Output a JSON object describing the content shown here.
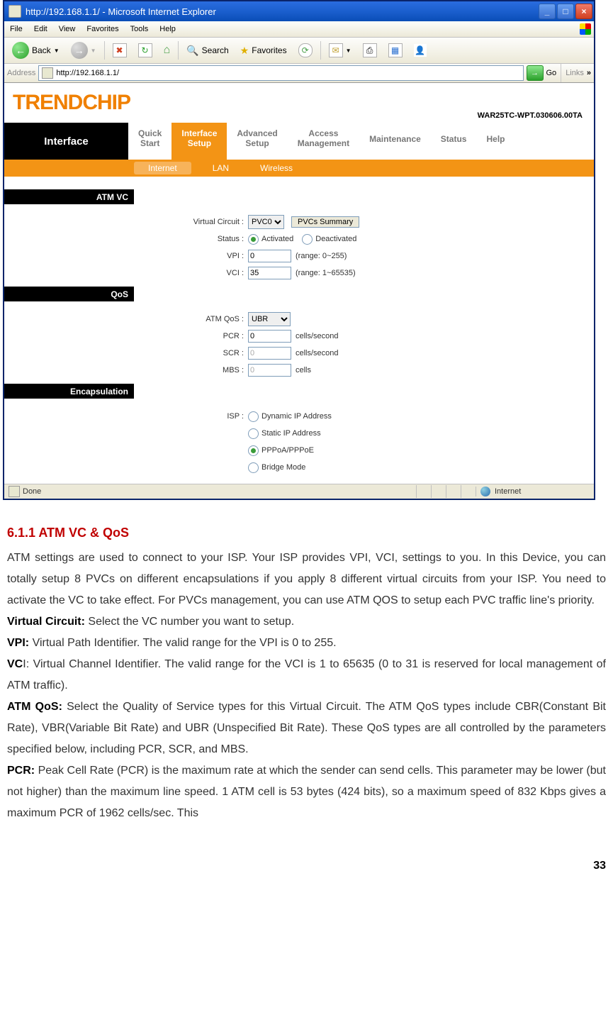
{
  "window": {
    "title": "http://192.168.1.1/ - Microsoft Internet Explorer"
  },
  "menubar": [
    "File",
    "Edit",
    "View",
    "Favorites",
    "Tools",
    "Help"
  ],
  "toolbar": {
    "back": "Back",
    "search": "Search",
    "favorites": "Favorites"
  },
  "addressbar": {
    "label": "Address",
    "url": "http://192.168.1.1/",
    "go": "Go",
    "links": "Links"
  },
  "brand": {
    "logo": "TRENDCHIP",
    "firmware": "WAR25TC-WPT.030606.00TA"
  },
  "sidetitle": "Interface",
  "tabs": {
    "quick": {
      "l1": "Quick",
      "l2": "Start"
    },
    "iface": {
      "l1": "Interface",
      "l2": "Setup"
    },
    "adv": {
      "l1": "Advanced",
      "l2": "Setup"
    },
    "acc": {
      "l1": "Access",
      "l2": "Management"
    },
    "maint": {
      "l1": "Maintenance",
      "l2": ""
    },
    "status": {
      "l1": "Status",
      "l2": ""
    },
    "help": {
      "l1": "Help",
      "l2": ""
    }
  },
  "subtabs": {
    "internet": "Internet",
    "lan": "LAN",
    "wireless": "Wireless"
  },
  "sections": {
    "atmvc": "ATM VC",
    "qos": "QoS",
    "encap": "Encapsulation"
  },
  "atm": {
    "vc_label": "Virtual Circuit :",
    "vc_value": "PVC0",
    "pvcs_btn": "PVCs Summary",
    "status_label": "Status :",
    "status_on": "Activated",
    "status_off": "Deactivated",
    "vpi_label": "VPI :",
    "vpi_value": "0",
    "vpi_hint": "(range: 0~255)",
    "vci_label": "VCI :",
    "vci_value": "35",
    "vci_hint": "(range: 1~65535)"
  },
  "qos": {
    "type_label": "ATM QoS :",
    "type_value": "UBR",
    "pcr_label": "PCR :",
    "pcr_value": "0",
    "pcr_hint": "cells/second",
    "scr_label": "SCR :",
    "scr_value": "0",
    "scr_hint": "cells/second",
    "mbs_label": "MBS :",
    "mbs_value": "0",
    "mbs_hint": "cells"
  },
  "isp": {
    "label": "ISP :",
    "opt1": "Dynamic IP Address",
    "opt2": "Static IP Address",
    "opt3": "PPPoA/PPPoE",
    "opt4": "Bridge Mode"
  },
  "statusbar": {
    "done": "Done",
    "zone": "Internet"
  },
  "doc": {
    "heading": "6.1.1 ATM VC & QoS",
    "p1": "ATM settings are used to connect to your ISP. Your ISP provides VPI, VCI, settings to you. In this Device, you can totally setup 8 PVCs on different encapsulations if you apply 8 different virtual circuits from your ISP. You need to activate the VC to take effect. For PVCs management, you can use ATM QOS to setup each PVC traffic line's priority.",
    "vc_b": "Virtual Circuit:",
    "vc_t": " Select the VC number you want to setup.",
    "vpi_b": "VPI:",
    "vpi_t": " Virtual Path Identifier. The valid range for the VPI is 0 to 255.",
    "vci_b1": "VC",
    "vci_b2": "I",
    "vci_t": ": Virtual Channel Identifier. The valid range for the VCI is 1 to 65635 (0 to 31 is reserved for local management of ATM traffic).",
    "qos_b": "ATM QoS:",
    "qos_t": " Select the Quality of Service types for this Virtual Circuit. The ATM QoS types include CBR(Constant Bit Rate), VBR(Variable Bit Rate) and UBR (Unspecified Bit Rate). These QoS types are all controlled by the parameters specified below, including PCR, SCR, and MBS.",
    "pcr_b": "PCR:",
    "pcr_t": " Peak Cell Rate (PCR) is the maximum rate at which the sender can send cells. This parameter may be lower (but not higher) than the maximum line speed. 1 ATM cell is 53 bytes (424 bits), so a maximum speed of 832 Kbps gives a maximum PCR of 1962 cells/sec. This",
    "page": "33"
  }
}
